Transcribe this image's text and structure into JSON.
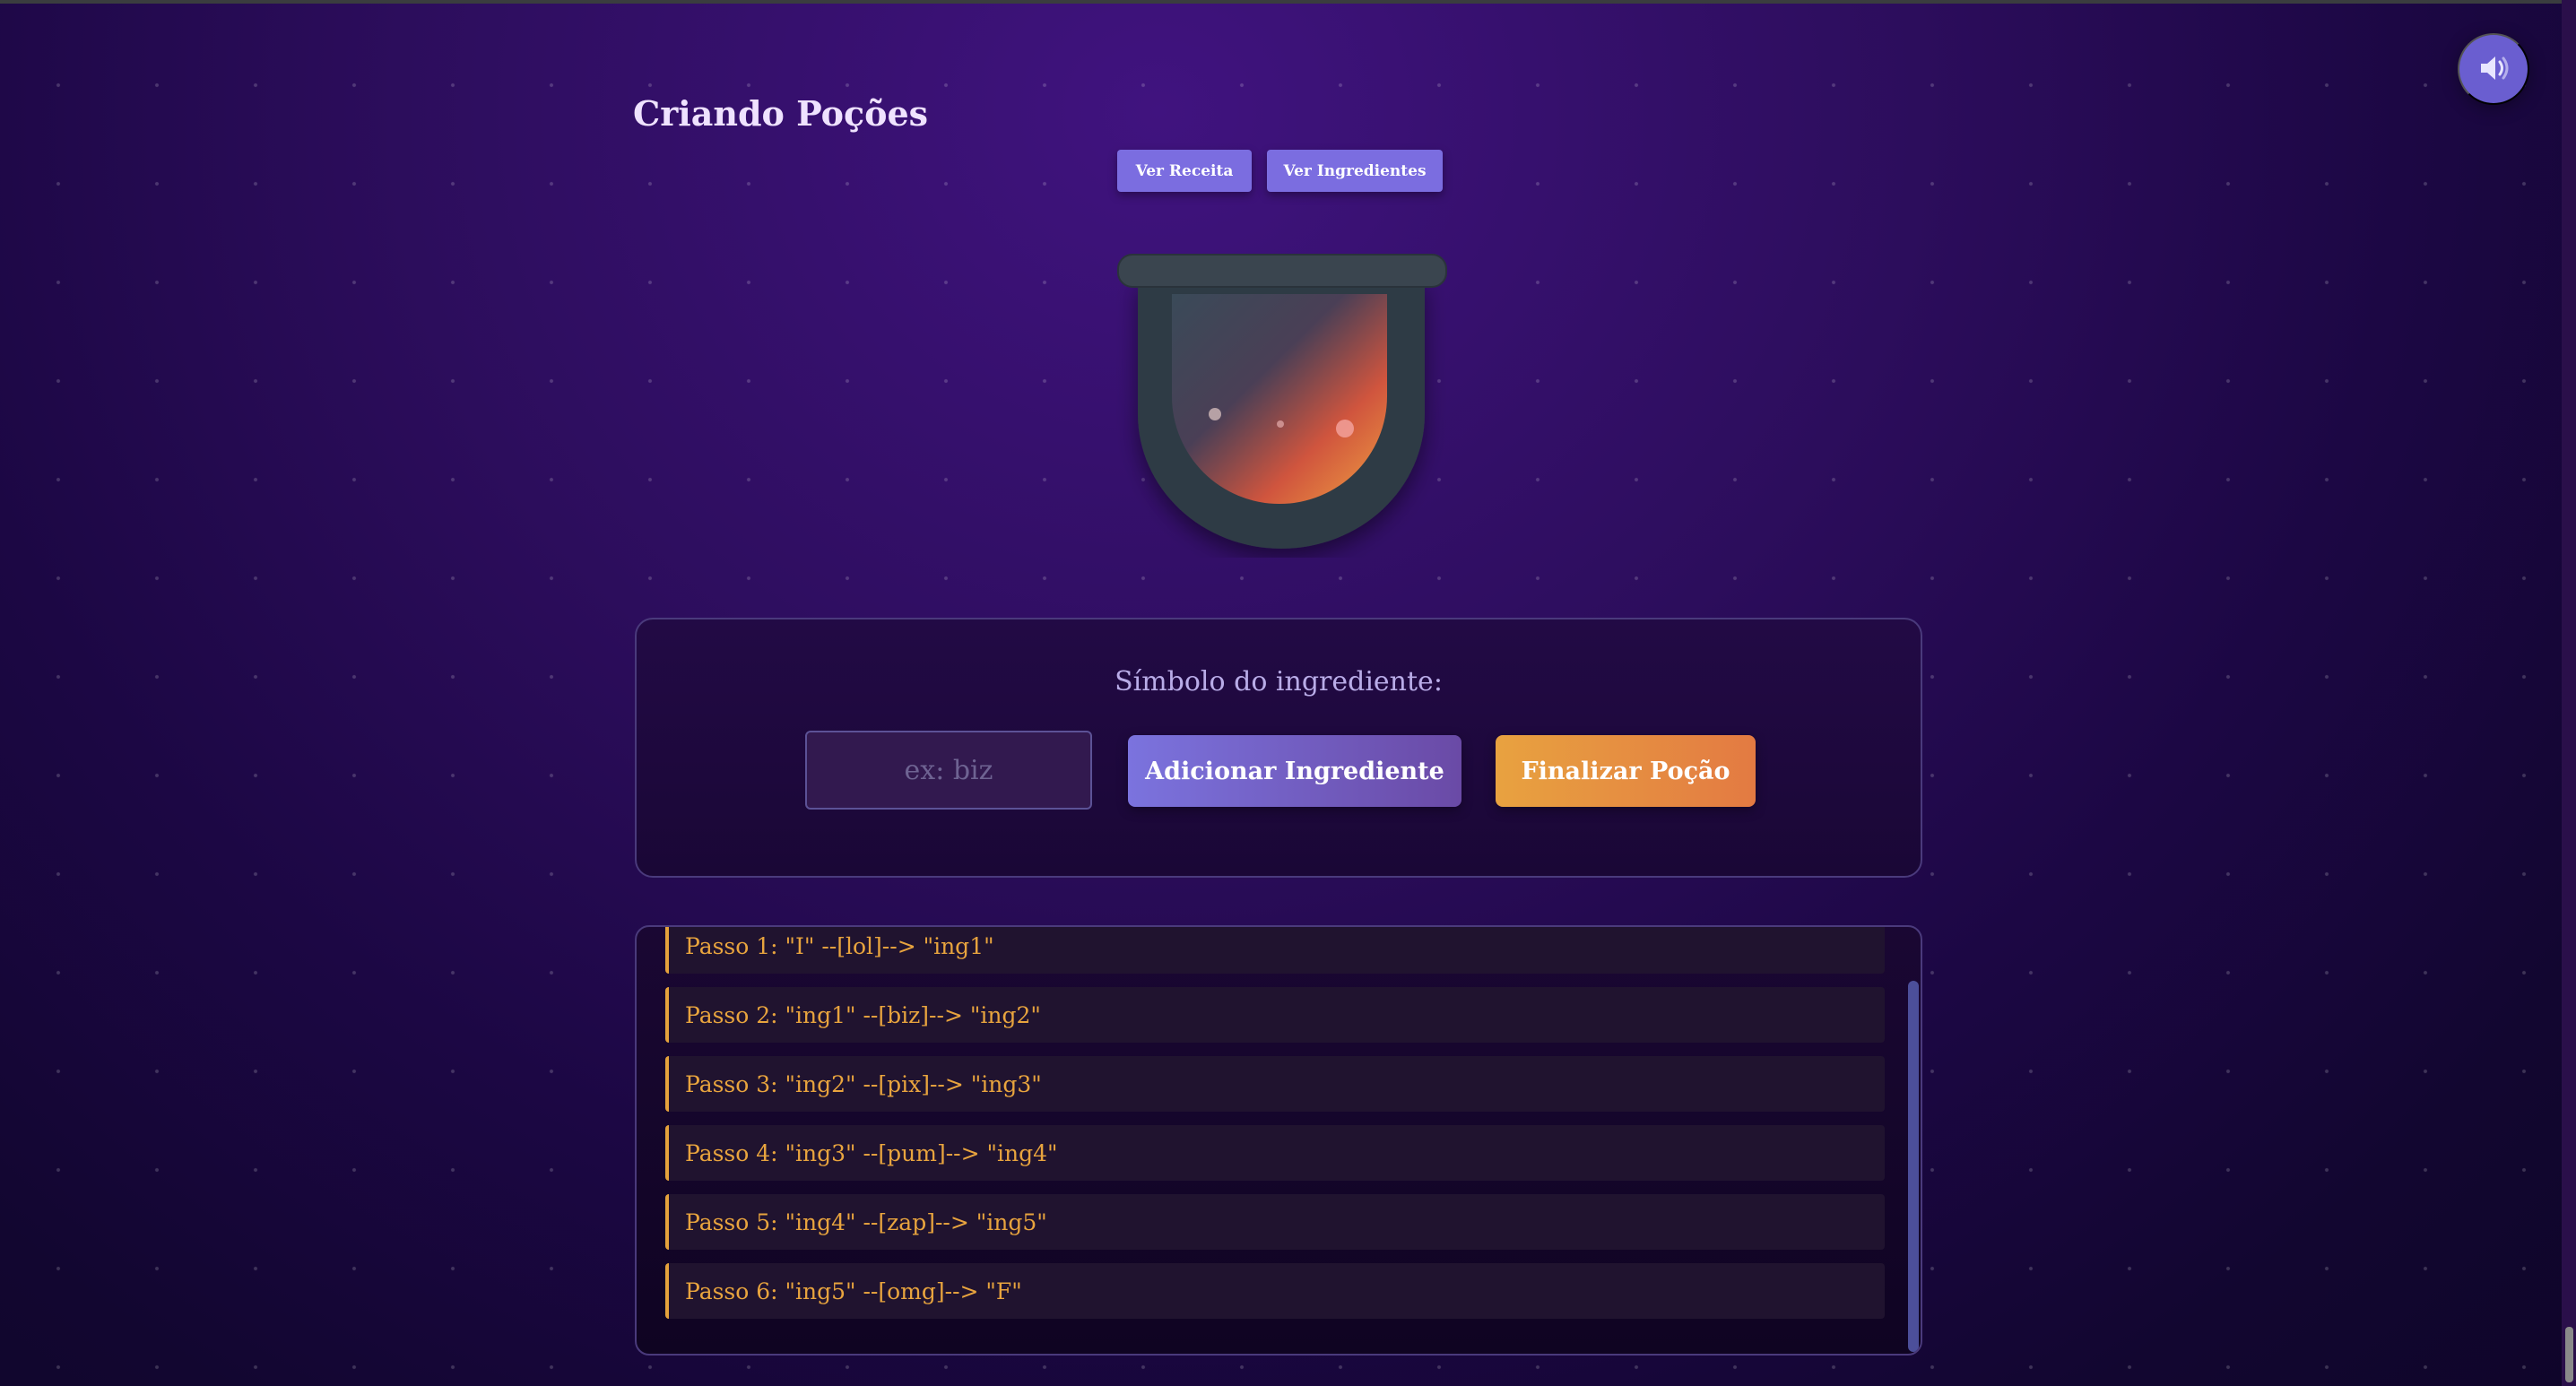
{
  "app": {
    "title": "Criando Poções"
  },
  "toolbar": {
    "recipe_label": "Ver Receita",
    "ingredients_label": "Ver Ingredientes",
    "sound_icon": "speaker-icon"
  },
  "ingredient_panel": {
    "label": "Símbolo do ingrediente:",
    "input_value": "",
    "input_placeholder": "ex: biz",
    "add_label": "Adicionar Ingrediente",
    "finish_label": "Finalizar Poção"
  },
  "steps": [
    {
      "text": "Passo 1: \"I\" --[lol]--> \"ing1\""
    },
    {
      "text": "Passo 2: \"ing1\" --[biz]--> \"ing2\""
    },
    {
      "text": "Passo 3: \"ing2\" --[pix]--> \"ing3\""
    },
    {
      "text": "Passo 4: \"ing3\" --[pum]--> \"ing4\""
    },
    {
      "text": "Passo 5: \"ing4\" --[zap]--> \"ing5\""
    },
    {
      "text": "Passo 6: \"ing5\" --[omg]--> \"F\""
    }
  ],
  "colors": {
    "accent": "#7b6de0",
    "finish": "#e8a240",
    "step_text": "#e8a43e",
    "potion_top": "#3e4a55",
    "potion_bottom": "#e25a3a"
  }
}
